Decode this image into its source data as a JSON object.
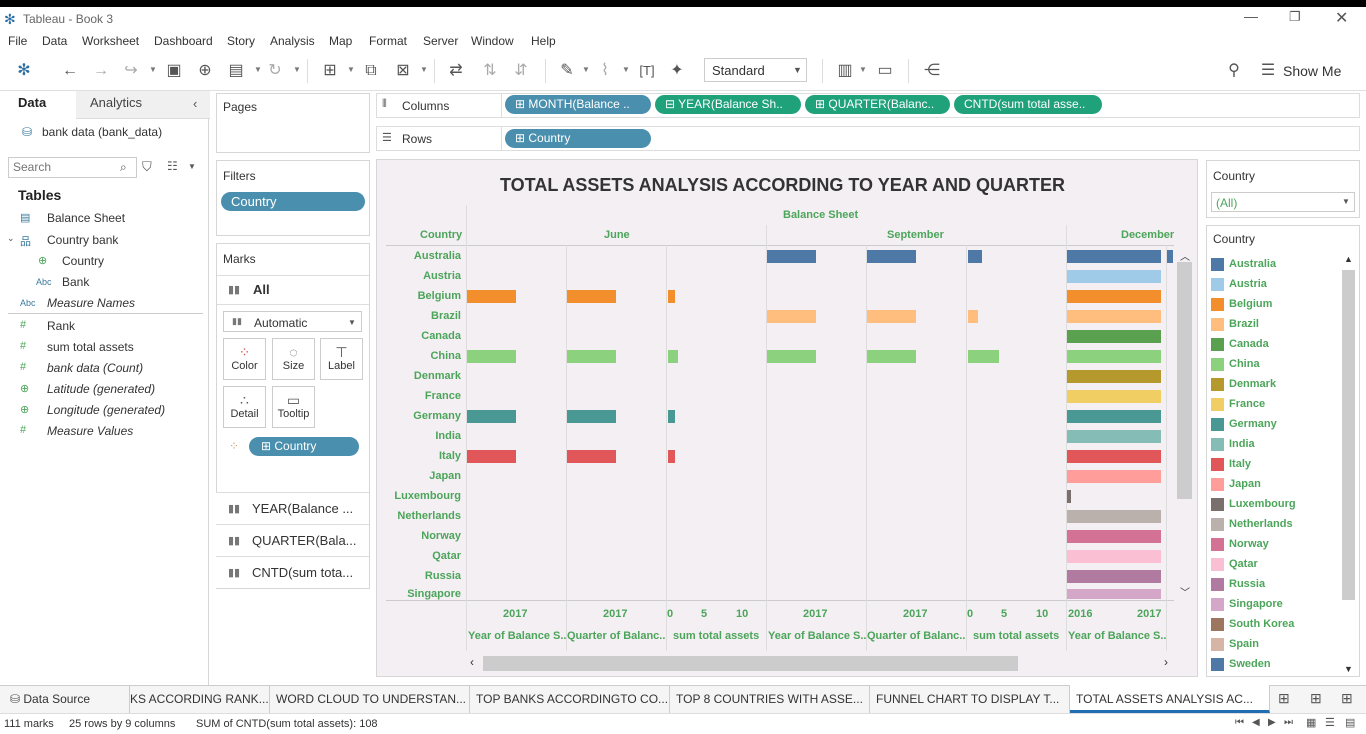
{
  "window": {
    "title": "Tableau - Book 3"
  },
  "menu": [
    "File",
    "Data",
    "Worksheet",
    "Dashboard",
    "Story",
    "Analysis",
    "Map",
    "Format",
    "Server",
    "Window",
    "Help"
  ],
  "toolbar": {
    "mark_type": "Standard",
    "show_me": "Show Me"
  },
  "left": {
    "tab_data": "Data",
    "tab_analytics": "Analytics",
    "datasource": "bank data (bank_data)",
    "search_placeholder": "Search",
    "tables_heading": "Tables",
    "fields": [
      "Balance Sheet",
      "Country bank",
      "Country",
      "Bank",
      "Measure Names",
      "Rank",
      "sum total assets",
      "bank data (Count)",
      "Latitude (generated)",
      "Longitude (generated)",
      "Measure Values"
    ]
  },
  "shelves": {
    "pages": "Pages",
    "filters": "Filters",
    "filter_pill": "Country",
    "marks": "Marks",
    "marks_all": "All",
    "marks_type": "Automatic",
    "mark_buttons": [
      "Color",
      "Size",
      "Label",
      "Detail",
      "Tooltip"
    ],
    "marks_pill": "Country",
    "marks_cards": [
      "YEAR(Balance ...",
      "QUARTER(Bala...",
      "CNTD(sum tota..."
    ],
    "columns": "Columns",
    "rows": "Rows",
    "col_pills": [
      "MONTH(Balance ..",
      "YEAR(Balance Sh..",
      "QUARTER(Balanc..",
      "CNTD(sum total asse.."
    ],
    "row_pill": "Country"
  },
  "viz": {
    "title": "TOTAL ASSETS ANALYSIS ACCORDING TO YEAR AND QUARTER",
    "header_top": "Balance Sheet",
    "country_header": "Country",
    "months": [
      "June",
      "September",
      "December"
    ],
    "countries": [
      "Australia",
      "Austria",
      "Belgium",
      "Brazil",
      "Canada",
      "China",
      "Denmark",
      "France",
      "Germany",
      "India",
      "Italy",
      "Japan",
      "Luxembourg",
      "Netherlands",
      "Norway",
      "Qatar",
      "Russia",
      "Singapore"
    ],
    "axis_ticks": [
      "2017",
      "2017",
      "0",
      "5",
      "10",
      "2017",
      "2017",
      "0",
      "5",
      "10",
      "2016",
      "2017"
    ],
    "axis_titles": [
      "Year of Balance S..",
      "Quarter of Balanc..",
      "sum total assets",
      "Year of Balance S..",
      "Quarter of Balanc..",
      "sum total assets",
      "Year of Balance S.."
    ]
  },
  "chart_data": {
    "type": "bar",
    "title": "TOTAL ASSETS ANALYSIS ACCORDING TO YEAR AND QUARTER",
    "categories": [
      "Australia",
      "Austria",
      "Belgium",
      "Brazil",
      "Canada",
      "China",
      "Denmark",
      "France",
      "Germany",
      "India",
      "Italy",
      "Japan",
      "Luxembourg",
      "Netherlands",
      "Norway",
      "Qatar",
      "Russia",
      "Singapore"
    ],
    "series": [
      {
        "name": "June",
        "values": [
          0,
          0,
          1,
          0,
          0,
          2,
          0,
          0,
          1,
          0,
          1,
          0,
          0,
          0,
          0,
          0,
          0,
          0
        ]
      },
      {
        "name": "September",
        "values": [
          3,
          0,
          0,
          2,
          0,
          8,
          0,
          0,
          0,
          0,
          0,
          0,
          0,
          0,
          0,
          0,
          0,
          0
        ]
      }
    ],
    "xlim": [
      0,
      10
    ]
  },
  "legend_filter": {
    "title": "Country",
    "value": "(All)"
  },
  "legend": {
    "title": "Country",
    "items": [
      {
        "name": "Australia",
        "color": "#4e79a7"
      },
      {
        "name": "Austria",
        "color": "#a0cbe8"
      },
      {
        "name": "Belgium",
        "color": "#f28e2b"
      },
      {
        "name": "Brazil",
        "color": "#ffbe7d"
      },
      {
        "name": "Canada",
        "color": "#59a14f"
      },
      {
        "name": "China",
        "color": "#8cd17d"
      },
      {
        "name": "Denmark",
        "color": "#b6992d"
      },
      {
        "name": "France",
        "color": "#f1ce63"
      },
      {
        "name": "Germany",
        "color": "#499894"
      },
      {
        "name": "India",
        "color": "#86bcb6"
      },
      {
        "name": "Italy",
        "color": "#e15759"
      },
      {
        "name": "Japan",
        "color": "#ff9d9a"
      },
      {
        "name": "Luxembourg",
        "color": "#79706e"
      },
      {
        "name": "Netherlands",
        "color": "#bab0ac"
      },
      {
        "name": "Norway",
        "color": "#d37295"
      },
      {
        "name": "Qatar",
        "color": "#fabfd2"
      },
      {
        "name": "Russia",
        "color": "#b07aa1"
      },
      {
        "name": "Singapore",
        "color": "#d4a6c8"
      },
      {
        "name": "South Korea",
        "color": "#9d7660"
      },
      {
        "name": "Spain",
        "color": "#d7b5a6"
      },
      {
        "name": "Sweden",
        "color": "#4e79a7"
      }
    ]
  },
  "sheets": [
    "Data Source",
    "KS ACCORDING RANK...",
    "WORD CLOUD TO UNDERSTAN...",
    "TOP BANKS ACCORDINGTO CO...",
    "TOP 8 COUNTRIES WITH ASSE...",
    "FUNNEL CHART TO DISPLAY T...",
    "TOTAL ASSETS ANALYSIS AC..."
  ],
  "status": {
    "marks": "111 marks",
    "rows": "25 rows by 9 columns",
    "sum": "SUM of CNTD(sum total assets): 108"
  }
}
